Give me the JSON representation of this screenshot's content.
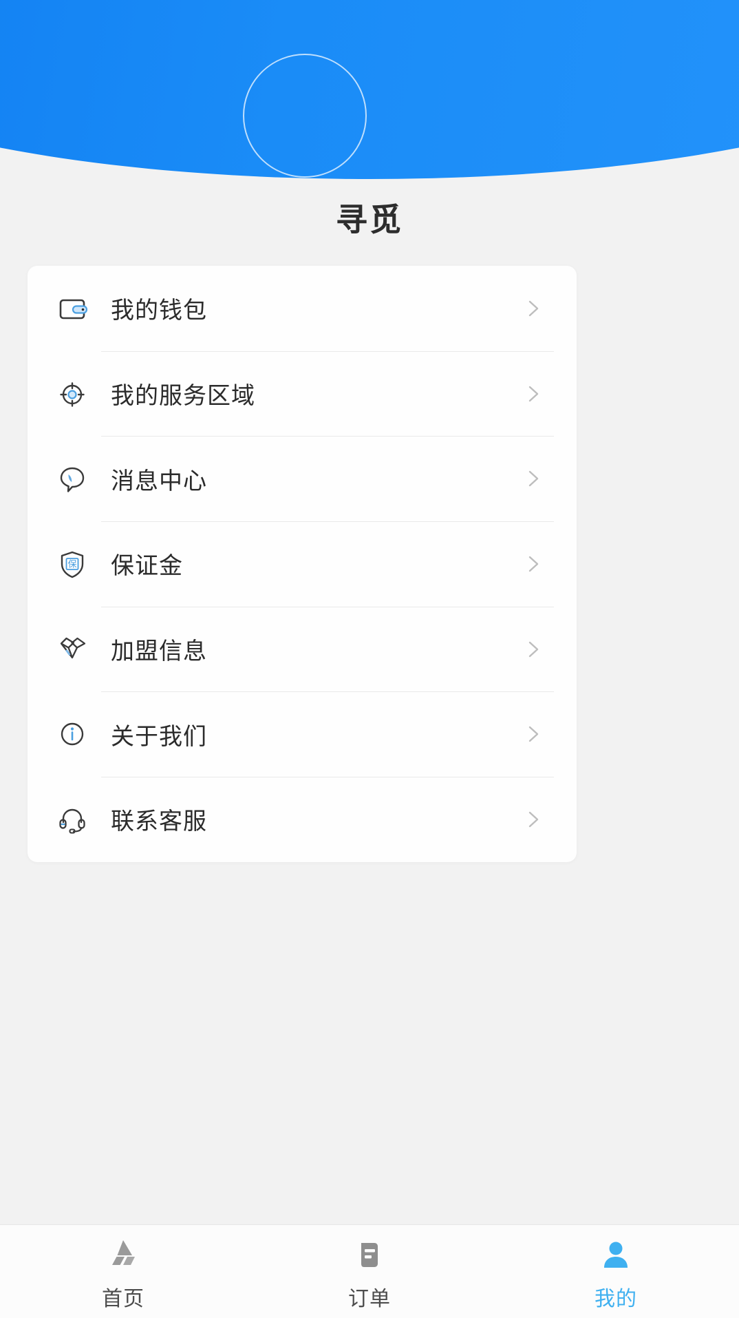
{
  "app": {
    "title": "寻觅",
    "header_color": "#1589f0",
    "accent_color": "#3fb0f0",
    "page_background": "#f2f2f2",
    "card_background": "#fefefe"
  },
  "profile": {
    "avatar_icon": "avatar-placeholder-circle"
  },
  "menu": {
    "items": [
      {
        "label": "我的钱包",
        "icon": "wallet-icon",
        "chevron": "chevron-right-icon"
      },
      {
        "label": "我的服务区域",
        "icon": "target-location-icon",
        "chevron": "chevron-right-icon"
      },
      {
        "label": "消息中心",
        "icon": "message-bubble-icon",
        "chevron": "chevron-right-icon"
      },
      {
        "label": "保证金",
        "icon": "shield-deposit-icon",
        "chevron": "chevron-right-icon"
      },
      {
        "label": "加盟信息",
        "icon": "handshake-icon",
        "chevron": "chevron-right-icon"
      },
      {
        "label": "关于我们",
        "icon": "info-circle-icon",
        "chevron": "chevron-right-icon"
      },
      {
        "label": "联系客服",
        "icon": "headset-support-icon",
        "chevron": "chevron-right-icon"
      }
    ]
  },
  "tabbar": {
    "items": [
      {
        "label": "首页",
        "icon": "home-triangle-icon",
        "active": false
      },
      {
        "label": "订单",
        "icon": "order-document-icon",
        "active": false
      },
      {
        "label": "我的",
        "icon": "user-person-icon",
        "active": true
      }
    ]
  }
}
